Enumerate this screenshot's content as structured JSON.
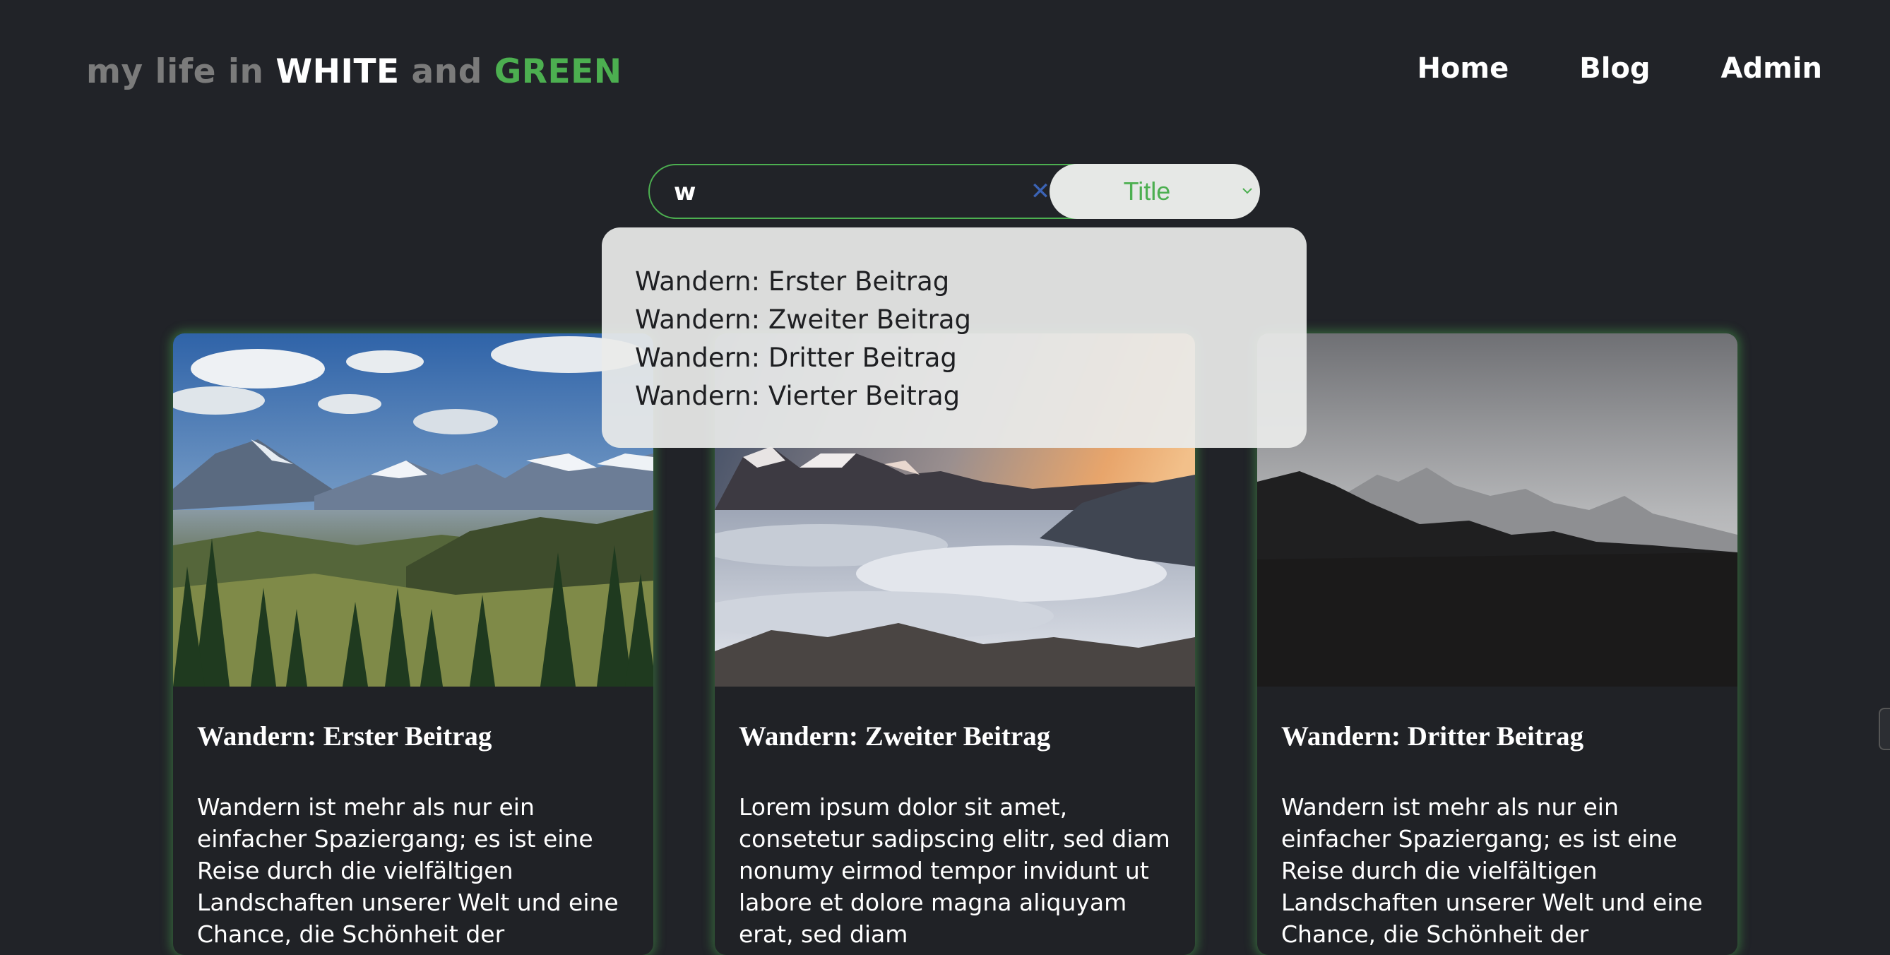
{
  "brand": {
    "part1": "my life in ",
    "part2": "WHITE",
    "part3": " and ",
    "part4": "GREEN"
  },
  "nav": {
    "home": "Home",
    "blog": "Blog",
    "admin": "Admin"
  },
  "search": {
    "value": "w",
    "clear_icon": "close-icon",
    "filter_selected": "Title"
  },
  "suggestions": [
    "Wandern: Erster Beitrag",
    "Wandern: Zweiter Beitrag",
    "Wandern: Dritter Beitrag",
    "Wandern: Vierter Beitrag"
  ],
  "cards": [
    {
      "title": "Wandern: Erster Beitrag",
      "text": "Wandern ist mehr als nur ein einfacher Spaziergang; es ist eine Reise durch die vielfältigen Landschaften unserer Welt und eine Chance, die Schönheit der",
      "image": "mountain-forest-landscape"
    },
    {
      "title": "Wandern: Zweiter Beitrag",
      "text": "Lorem ipsum dolor sit amet, consetetur sadipscing elitr, sed diam nonumy eirmod tempor invidunt ut labore et dolore magna aliquyam erat, sed diam",
      "image": "mountains-above-clouds"
    },
    {
      "title": "Wandern: Dritter Beitrag",
      "text": "Wandern ist mehr als nur ein einfacher Spaziergang; es ist eine Reise durch die vielfältigen Landschaften unserer Welt und eine Chance, die Schönheit der",
      "image": "foggy-mountain-silhouette"
    }
  ],
  "colors": {
    "background": "#212328",
    "accent_green": "#4caf50",
    "muted_gray": "#7b7b7b"
  }
}
